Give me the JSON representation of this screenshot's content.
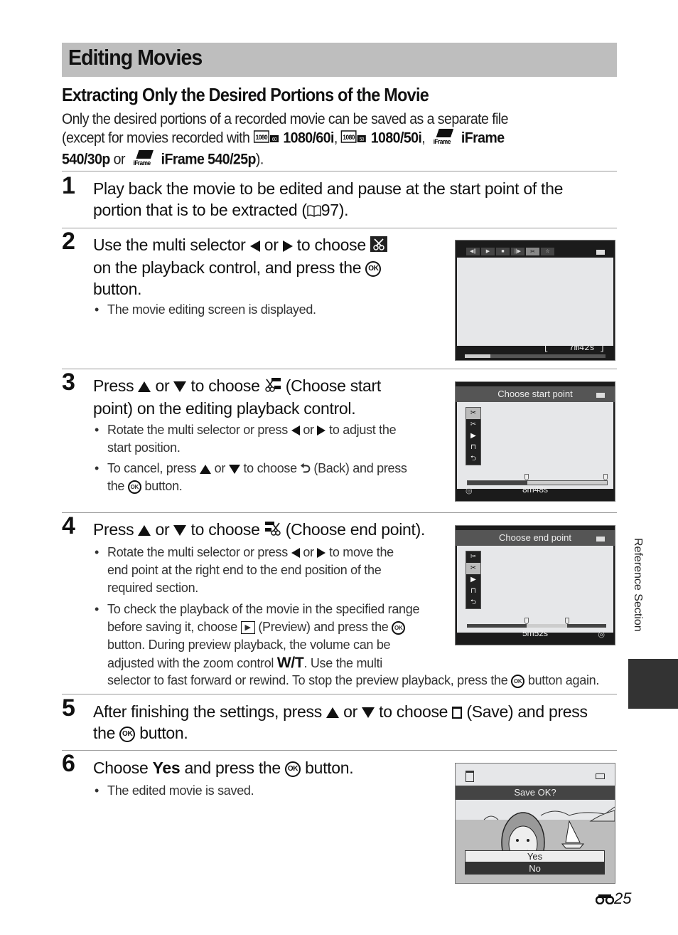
{
  "page": {
    "title": "Editing Movies",
    "subtitle": "Extracting Only the Desired Portions of the Movie",
    "intro": {
      "line1": "Only the desired portions of a recorded movie can be saved as a separate file",
      "line2_prefix": "(except for movies recorded with",
      "mode1": "1080/60i",
      "mode2": "1080/50i",
      "mode3": "iFrame",
      "line3_mode3_cont": "540/30p",
      "or": "or",
      "mode4": "iFrame 540/25p",
      "close": ").",
      "icon_badge_1080": "1080",
      "icon_badge_60": "60",
      "icon_badge_50": "50",
      "icon_iframe": "iFrame"
    },
    "side_label": "Reference Section",
    "page_number": "25",
    "accent_gray": "#bebebe"
  },
  "steps": [
    {
      "number": "1",
      "text_a": "Play back the movie to be edited and pause at the start point of the",
      "text_b": "portion that is to be extracted (",
      "ref_page": "97",
      "text_c": ")."
    },
    {
      "number": "2",
      "line1_a": "Use the multi selector",
      "or": "or",
      "line1_b": "to choose",
      "line2": "on the playback control, and press the",
      "line3": "button.",
      "bullets": [
        "The movie editing screen is displayed."
      ]
    },
    {
      "number": "3",
      "line1_a": "Press",
      "or": "or",
      "line1_b": "to choose",
      "line1_c": "(Choose start",
      "line2": "point) on the editing playback control.",
      "bullet1_a": "Rotate the multi selector or press",
      "bullet1_b": "to adjust the",
      "bullet1_c": "start position.",
      "bullet2_a": "To cancel, press",
      "bullet2_b": "to choose",
      "bullet2_c": "(Back) and press",
      "bullet2_d": "the",
      "bullet2_e": "button."
    },
    {
      "number": "4",
      "line1_a": "Press",
      "or": "or",
      "line1_b": "to choose",
      "line1_c": "(Choose end point).",
      "bullet1_a": "Rotate the multi selector or press",
      "bullet1_b": "to move the",
      "bullet1_c": "end point at the right end to the end position of the",
      "bullet1_d": "required section.",
      "bullet2_a": "To check the playback of the movie in the specified range",
      "bullet2_b": "before saving it, choose",
      "bullet2_c": "(Preview) and press the",
      "bullet2_d": "button. During preview playback, the volume can be",
      "bullet2_e": "adjusted with the zoom control",
      "bullet2_wt": "W/T",
      "bullet2_f": ". Use the multi",
      "bullet2_g": "selector to fast forward or rewind. To stop the preview playback, press the",
      "bullet2_h": "button again."
    },
    {
      "number": "5",
      "line1_a": "After finishing the settings, press",
      "or": "or",
      "line1_b": "to choose",
      "line1_c": "(Save) and press",
      "line2_a": "the",
      "line2_b": "button."
    },
    {
      "number": "6",
      "line1_a": "Choose",
      "yes": "Yes",
      "line1_b": "and press the",
      "line1_c": "button.",
      "bullets": [
        "The edited movie is saved."
      ]
    }
  ],
  "ok_label": "OK",
  "screens": {
    "playback": {
      "time": "[    7m42s ]",
      "progress": 0.18,
      "controls": [
        "frame-back",
        "play",
        "stop",
        "frame-forward",
        "edit",
        "favorite"
      ]
    },
    "start_point": {
      "header": "Choose start point",
      "time": "8m48s",
      "marker_start": 0.43,
      "marker_end": 1.0
    },
    "end_point": {
      "header": "Choose end point",
      "time": "5m52s",
      "marker_start": 0.43,
      "marker_end": 0.72
    },
    "save": {
      "header": "Save OK?",
      "options": [
        "Yes",
        "No"
      ],
      "selected": "Yes"
    }
  }
}
